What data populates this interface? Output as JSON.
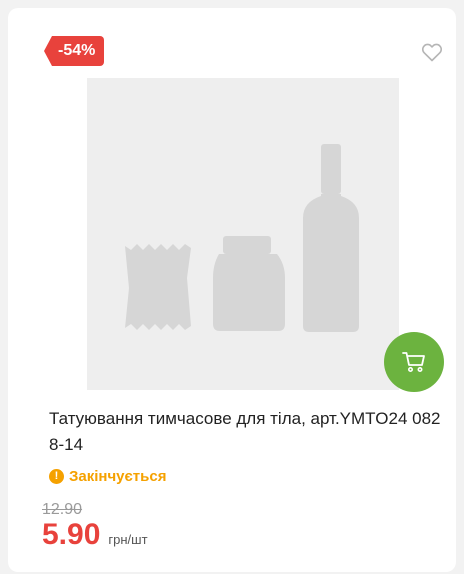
{
  "badge": {
    "discount": "-54%"
  },
  "product": {
    "name": "Татуювання тимчасове для тіла, арт.YMTO24 0828-14",
    "status": "Закінчується",
    "old_price": "12.90",
    "price": "5.90",
    "unit": "грн/шт"
  },
  "icons": {
    "favorite": "heart-outline-icon",
    "cart": "cart-icon",
    "status": "exclamation-circle-icon"
  },
  "colors": {
    "accent": "#e8423c",
    "cart_button": "#6cb33f",
    "status": "#f5a100",
    "placeholder": "#eeeeee"
  }
}
